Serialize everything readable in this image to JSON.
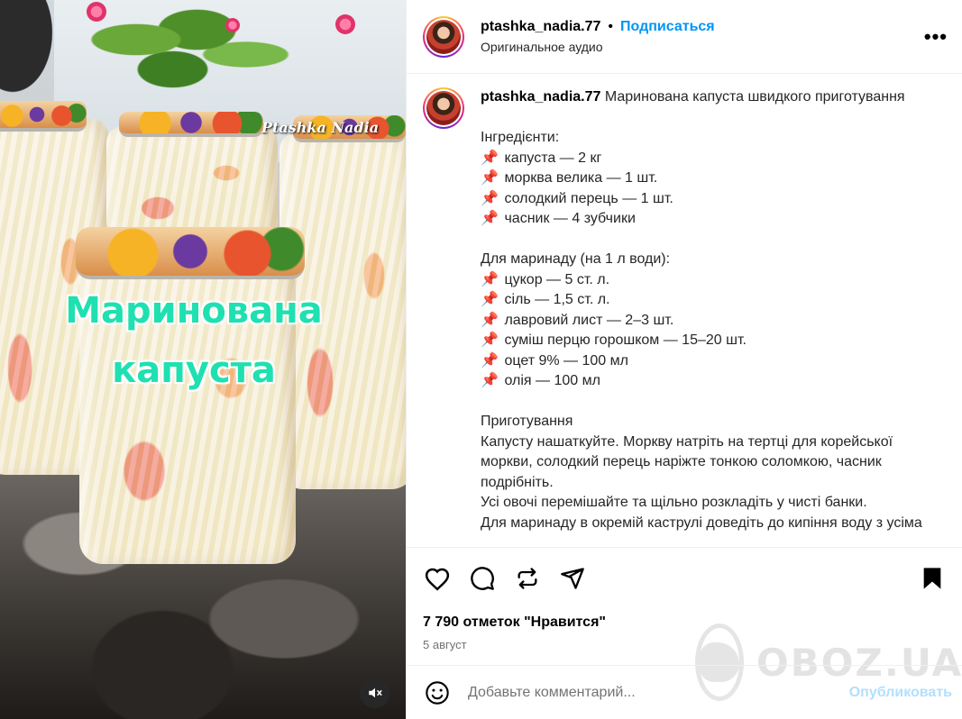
{
  "media": {
    "watermark_handle": "Ptashka Nadia",
    "overlay_title_line1": "Маринована",
    "overlay_title_line2": "капуста",
    "mute_icon": "speaker-muted-icon"
  },
  "header": {
    "username": "ptashka_nadia.77",
    "separator": "•",
    "follow_label": "Подписаться",
    "audio_label": "Оригинальное аудио",
    "more_label": "•••"
  },
  "caption": {
    "username": "ptashka_nadia.77",
    "title": "Маринована капуста швидкого приготування",
    "ingredients_heading": "Інгредієнти:",
    "pin_icon": "📌",
    "ingredients": [
      "капуста — 2 кг",
      "морква велика — 1 шт.",
      "солодкий перець — 1 шт.",
      "часник — 4 зубчики"
    ],
    "marinade_heading": "Для маринаду (на 1 л води):",
    "marinade": [
      "цукор — 5 ст. л.",
      "сіль — 1,5 ст. л.",
      "лавровий лист — 2–3 шт.",
      "суміш перцю горошком — 15–20 шт.",
      "оцет 9% — 100 мл",
      "олія — 100 мл"
    ],
    "prep_heading": "Приготування",
    "prep_text_1": "Капусту нашаткуйте. Моркву натріть на тертці для корейської моркви, солодкий перець наріжте тонкою соломкою, часник подрібніть.",
    "prep_text_2": "Усі овочі перемішайте та щільно розкладіть у чисті банки.",
    "prep_text_3": "Для маринаду в окремій каструлі доведіть до кипіння воду з усіма"
  },
  "actions": {
    "like_icon": "heart-icon",
    "comment_icon": "comment-icon",
    "repost_icon": "repost-icon",
    "share_icon": "send-icon",
    "save_icon": "bookmark-icon",
    "likes_text": "7 790 отметок \"Нравится\"",
    "date_text": "5 август"
  },
  "comment": {
    "emoji_icon": "smiley-icon",
    "placeholder": "Добавьте комментарий...",
    "publish_label": "Опубликовать"
  },
  "site_watermark": "OBOZ.UA",
  "colors": {
    "accent": "#0095f6",
    "publish_disabled": "#b2dffc",
    "overlay_text": "#1fe0b0",
    "secondary_text": "#737373"
  }
}
